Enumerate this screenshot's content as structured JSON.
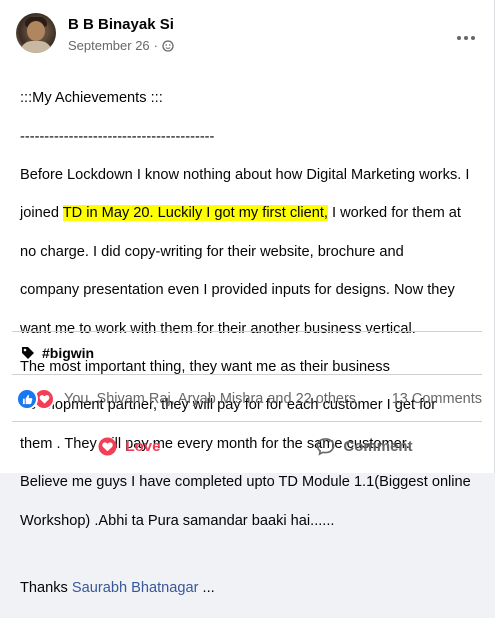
{
  "post": {
    "author_name": "B B Binayak Si",
    "date": "September 26",
    "separator": "·",
    "privacy_icon": "friends-icon",
    "heading": ":::My Achievements :::",
    "rule": "----------------------------------------",
    "body_lines": {
      "l1": "Before Lockdown I know nothing about how Digital Marketing works. I",
      "l2_pre": "joined ",
      "l2_highlight": "TD in May 20. Luckily I got my first client,",
      "l2_post": " I worked for them at",
      "l3": "no charge.  I did copy-writing  for their website, brochure and",
      "l4": "company presentation even I provided inputs for designs. Now they",
      "l5": "want me to work with them for their another business vertical.",
      "l6": "The most important thing, they want me as their business",
      "l7": "development partner, they will pay for for each customer I get for",
      "l8": "them . They will pay me every month for the same customer.",
      "l9": "Believe me guys I have completed upto TD Module 1.1(Biggest online",
      "l10": "Workshop) .Abhi ta Pura samandar baaki hai......"
    },
    "thanks_prefix": "Thanks ",
    "thanks_mention": "Saurabh Bhatnagar",
    "thanks_suffix": " ..."
  },
  "hashtag": {
    "text": "#bigwin",
    "icon": "tag-icon"
  },
  "reactions": {
    "icons": [
      "like-icon",
      "love-icon"
    ],
    "names": "You, Shivam Raj, Aryab Mishra and 22 others",
    "comment_count": "13 Comments"
  },
  "actions": {
    "love_label": "Love",
    "comment_label": "Comment"
  },
  "colors": {
    "love": "#f33e58",
    "like": "#1877f2",
    "mention": "#385898",
    "highlight": "#ffff00"
  }
}
